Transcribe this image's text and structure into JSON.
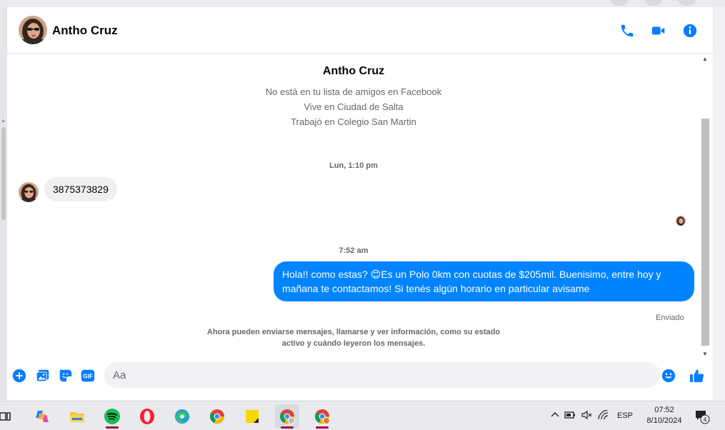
{
  "header": {
    "contact_name": "Antho Cruz"
  },
  "profile": {
    "name": "Antho Cruz",
    "lines": [
      "No está en tu lista de amigos en Facebook",
      "Vive en Ciudad de Salta",
      "Trabajó en Colegio San Martin"
    ]
  },
  "timestamps": {
    "first": "Lun, 1:10 pm",
    "second": "7:52 am"
  },
  "messages": {
    "incoming_1": "3875373829",
    "outgoing_1": "Hola!! como estas? 😊Es un Polo 0km con cuotas de $205mil. Buenisimo, entre hoy y mañana te contactamos! Si tenés algún horario en particular avisame",
    "sent_status": "Enviado"
  },
  "notice": {
    "line1": "Ahora pueden enviarse mensajes, llamarse y ver información, como su estado",
    "line2": "activo y cuándo leyeron los mensajes."
  },
  "composer": {
    "placeholder": "Aa",
    "gif_label": "GIF"
  },
  "colors": {
    "accent": "#0084ff",
    "messenger_blue": "#0a7cff"
  },
  "taskbar": {
    "apps": [
      "task-view",
      "copilot",
      "file-explorer",
      "spotify",
      "opera",
      "edge",
      "chrome",
      "sticky-notes",
      "chrome-profile-1",
      "chrome-profile-2"
    ],
    "language": "ESP",
    "time": "07:52",
    "date": "8/10/2024",
    "notification_count": "4"
  }
}
